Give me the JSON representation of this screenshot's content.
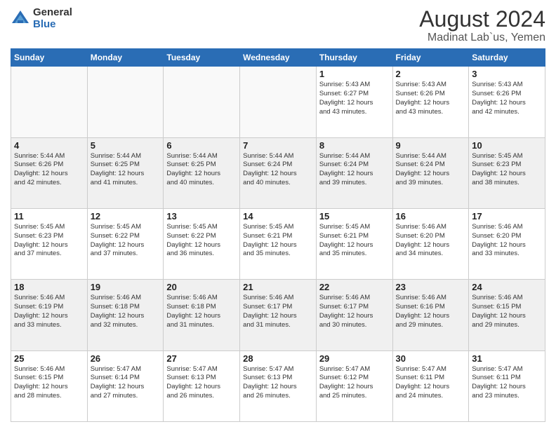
{
  "logo": {
    "general": "General",
    "blue": "Blue"
  },
  "title": "August 2024",
  "subtitle": "Madinat Lab`us, Yemen",
  "days_header": [
    "Sunday",
    "Monday",
    "Tuesday",
    "Wednesday",
    "Thursday",
    "Friday",
    "Saturday"
  ],
  "weeks": [
    [
      {
        "day": "",
        "info": "",
        "empty": true
      },
      {
        "day": "",
        "info": "",
        "empty": true
      },
      {
        "day": "",
        "info": "",
        "empty": true
      },
      {
        "day": "",
        "info": "",
        "empty": true
      },
      {
        "day": "1",
        "info": "Sunrise: 5:43 AM\nSunset: 6:27 PM\nDaylight: 12 hours\nand 43 minutes."
      },
      {
        "day": "2",
        "info": "Sunrise: 5:43 AM\nSunset: 6:26 PM\nDaylight: 12 hours\nand 43 minutes."
      },
      {
        "day": "3",
        "info": "Sunrise: 5:43 AM\nSunset: 6:26 PM\nDaylight: 12 hours\nand 42 minutes."
      }
    ],
    [
      {
        "day": "4",
        "info": "Sunrise: 5:44 AM\nSunset: 6:26 PM\nDaylight: 12 hours\nand 42 minutes."
      },
      {
        "day": "5",
        "info": "Sunrise: 5:44 AM\nSunset: 6:25 PM\nDaylight: 12 hours\nand 41 minutes."
      },
      {
        "day": "6",
        "info": "Sunrise: 5:44 AM\nSunset: 6:25 PM\nDaylight: 12 hours\nand 40 minutes."
      },
      {
        "day": "7",
        "info": "Sunrise: 5:44 AM\nSunset: 6:24 PM\nDaylight: 12 hours\nand 40 minutes."
      },
      {
        "day": "8",
        "info": "Sunrise: 5:44 AM\nSunset: 6:24 PM\nDaylight: 12 hours\nand 39 minutes."
      },
      {
        "day": "9",
        "info": "Sunrise: 5:44 AM\nSunset: 6:24 PM\nDaylight: 12 hours\nand 39 minutes."
      },
      {
        "day": "10",
        "info": "Sunrise: 5:45 AM\nSunset: 6:23 PM\nDaylight: 12 hours\nand 38 minutes."
      }
    ],
    [
      {
        "day": "11",
        "info": "Sunrise: 5:45 AM\nSunset: 6:23 PM\nDaylight: 12 hours\nand 37 minutes."
      },
      {
        "day": "12",
        "info": "Sunrise: 5:45 AM\nSunset: 6:22 PM\nDaylight: 12 hours\nand 37 minutes."
      },
      {
        "day": "13",
        "info": "Sunrise: 5:45 AM\nSunset: 6:22 PM\nDaylight: 12 hours\nand 36 minutes."
      },
      {
        "day": "14",
        "info": "Sunrise: 5:45 AM\nSunset: 6:21 PM\nDaylight: 12 hours\nand 35 minutes."
      },
      {
        "day": "15",
        "info": "Sunrise: 5:45 AM\nSunset: 6:21 PM\nDaylight: 12 hours\nand 35 minutes."
      },
      {
        "day": "16",
        "info": "Sunrise: 5:46 AM\nSunset: 6:20 PM\nDaylight: 12 hours\nand 34 minutes."
      },
      {
        "day": "17",
        "info": "Sunrise: 5:46 AM\nSunset: 6:20 PM\nDaylight: 12 hours\nand 33 minutes."
      }
    ],
    [
      {
        "day": "18",
        "info": "Sunrise: 5:46 AM\nSunset: 6:19 PM\nDaylight: 12 hours\nand 33 minutes."
      },
      {
        "day": "19",
        "info": "Sunrise: 5:46 AM\nSunset: 6:18 PM\nDaylight: 12 hours\nand 32 minutes."
      },
      {
        "day": "20",
        "info": "Sunrise: 5:46 AM\nSunset: 6:18 PM\nDaylight: 12 hours\nand 31 minutes."
      },
      {
        "day": "21",
        "info": "Sunrise: 5:46 AM\nSunset: 6:17 PM\nDaylight: 12 hours\nand 31 minutes."
      },
      {
        "day": "22",
        "info": "Sunrise: 5:46 AM\nSunset: 6:17 PM\nDaylight: 12 hours\nand 30 minutes."
      },
      {
        "day": "23",
        "info": "Sunrise: 5:46 AM\nSunset: 6:16 PM\nDaylight: 12 hours\nand 29 minutes."
      },
      {
        "day": "24",
        "info": "Sunrise: 5:46 AM\nSunset: 6:15 PM\nDaylight: 12 hours\nand 29 minutes."
      }
    ],
    [
      {
        "day": "25",
        "info": "Sunrise: 5:46 AM\nSunset: 6:15 PM\nDaylight: 12 hours\nand 28 minutes."
      },
      {
        "day": "26",
        "info": "Sunrise: 5:47 AM\nSunset: 6:14 PM\nDaylight: 12 hours\nand 27 minutes."
      },
      {
        "day": "27",
        "info": "Sunrise: 5:47 AM\nSunset: 6:13 PM\nDaylight: 12 hours\nand 26 minutes."
      },
      {
        "day": "28",
        "info": "Sunrise: 5:47 AM\nSunset: 6:13 PM\nDaylight: 12 hours\nand 26 minutes."
      },
      {
        "day": "29",
        "info": "Sunrise: 5:47 AM\nSunset: 6:12 PM\nDaylight: 12 hours\nand 25 minutes."
      },
      {
        "day": "30",
        "info": "Sunrise: 5:47 AM\nSunset: 6:11 PM\nDaylight: 12 hours\nand 24 minutes."
      },
      {
        "day": "31",
        "info": "Sunrise: 5:47 AM\nSunset: 6:11 PM\nDaylight: 12 hours\nand 23 minutes."
      }
    ]
  ]
}
